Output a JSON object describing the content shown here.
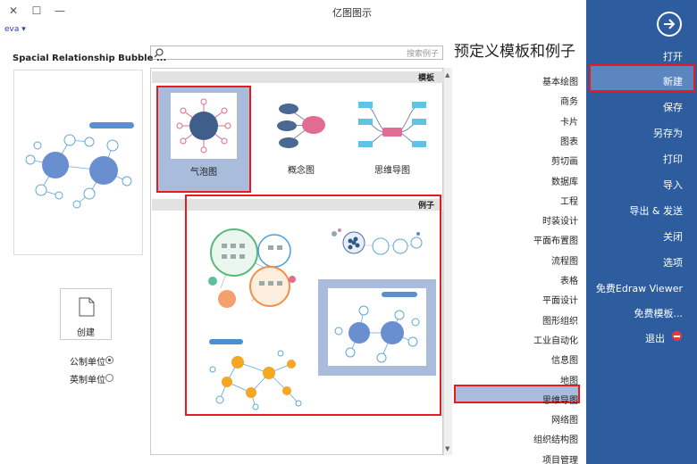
{
  "window": {
    "title": "亿图图示",
    "user": "eva ▾",
    "btn_close": "✕",
    "btn_max": "☐",
    "btn_min": "—"
  },
  "sidebar": {
    "items": [
      {
        "label": "打开"
      },
      {
        "label": "新建"
      },
      {
        "label": "保存"
      },
      {
        "label": "另存为"
      },
      {
        "label": "打印"
      },
      {
        "label": "导入"
      },
      {
        "label": "导出 & 发送"
      },
      {
        "label": "关闭"
      },
      {
        "label": "选项"
      },
      {
        "label": "免费Edraw Viewer"
      },
      {
        "label": "免费模板..."
      },
      {
        "label": "退出"
      }
    ],
    "selected": "新建"
  },
  "heading": "预定义模板和例子",
  "search": {
    "placeholder": "搜索例子"
  },
  "categories": [
    "基本绘图",
    "商务",
    "卡片",
    "图表",
    "剪切画",
    "数据库",
    "工程",
    "时装设计",
    "平面布置图",
    "流程图",
    "表格",
    "平面设计",
    "图形组织",
    "工业自动化",
    "信息图",
    "地图",
    "思维导图",
    "网络图",
    "组织结构图",
    "项目管理"
  ],
  "selected_category": "思维导图",
  "templates_section": {
    "title": "模板",
    "items": [
      {
        "label": "气泡图",
        "selected": true
      },
      {
        "label": "概念图",
        "selected": false
      },
      {
        "label": "思维导图",
        "selected": false
      }
    ]
  },
  "examples_section": {
    "title": "例子"
  },
  "preview": {
    "title": "Spacial Relationship Bubble ...",
    "create_label": "创建",
    "units": [
      {
        "label": "公制单位",
        "checked": true
      },
      {
        "label": "英制单位",
        "checked": false
      }
    ]
  },
  "colors": {
    "sidebar_bg": "#2d5d9f",
    "highlight": "#a9bcdb",
    "annotation_red": "#e81c1c"
  }
}
